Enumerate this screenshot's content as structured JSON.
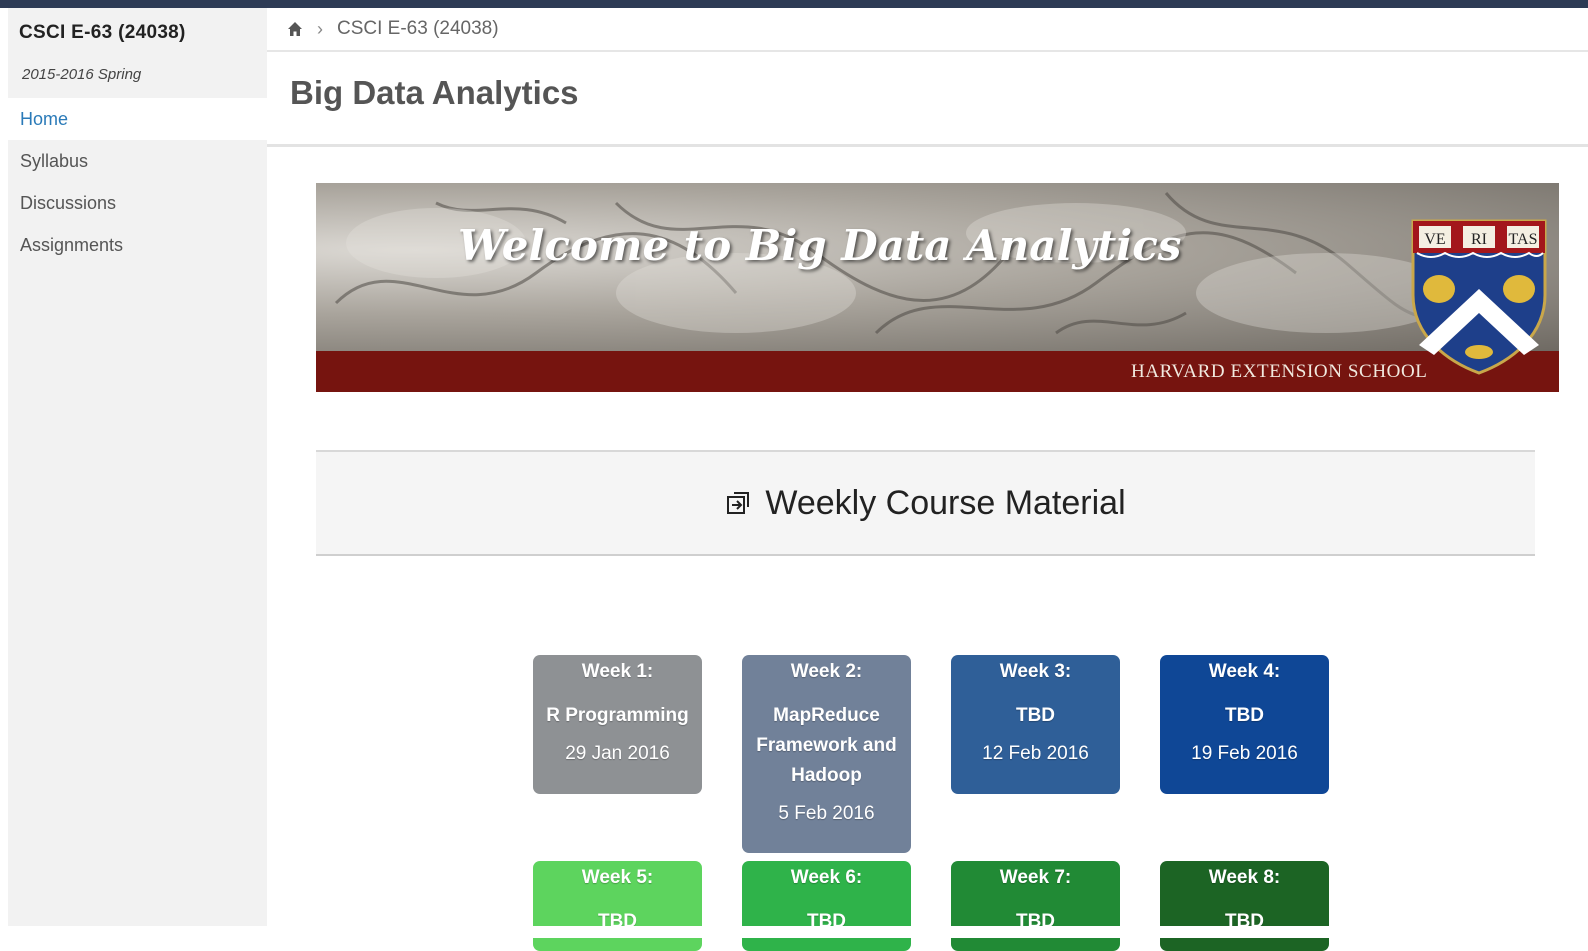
{
  "sidebar": {
    "course_code": "CSCI E-63 (24038)",
    "term": "2015-2016 Spring",
    "items": [
      {
        "label": "Home",
        "active": true
      },
      {
        "label": "Syllabus",
        "active": false
      },
      {
        "label": "Discussions",
        "active": false
      },
      {
        "label": "Assignments",
        "active": false
      }
    ]
  },
  "breadcrumb": {
    "home_icon": "home-icon",
    "current": "CSCI E-63 (24038)"
  },
  "page": {
    "title": "Big Data Analytics"
  },
  "banner": {
    "welcome": "Welcome to Big Data Analytics",
    "school": "HARVARD EXTENSION SCHOOL",
    "shield_text": [
      "VE",
      "RI",
      "TAS"
    ],
    "band_color": "#76140f"
  },
  "weekly": {
    "icon": "external-link-icon",
    "title": "Weekly Course Material"
  },
  "weeks": [
    {
      "week": "Week 1:",
      "topic": "R Programming",
      "date": "29 Jan 2016",
      "color": "#8e9194"
    },
    {
      "week": "Week 2:",
      "topic": "MapReduce Framework and Hadoop",
      "date": "5 Feb 2016",
      "color": "#718199"
    },
    {
      "week": "Week 3:",
      "topic": "TBD",
      "date": "12 Feb 2016",
      "color": "#2f5f98"
    },
    {
      "week": "Week 4:",
      "topic": "TBD",
      "date": "19 Feb 2016",
      "color": "#0f4796"
    },
    {
      "week": "Week 5:",
      "topic": "TBD",
      "date": "",
      "color": "#5dd45e"
    },
    {
      "week": "Week 6:",
      "topic": "TBD",
      "date": "",
      "color": "#2fb34a"
    },
    {
      "week": "Week 7:",
      "topic": "TBD",
      "date": "",
      "color": "#218a35"
    },
    {
      "week": "Week 8:",
      "topic": "TBD",
      "date": "",
      "color": "#1c6424"
    }
  ],
  "colors": {
    "topbar": "#2d3b55",
    "link_active": "#2a7ab8",
    "sidebar_bg": "#f2f2f2"
  }
}
